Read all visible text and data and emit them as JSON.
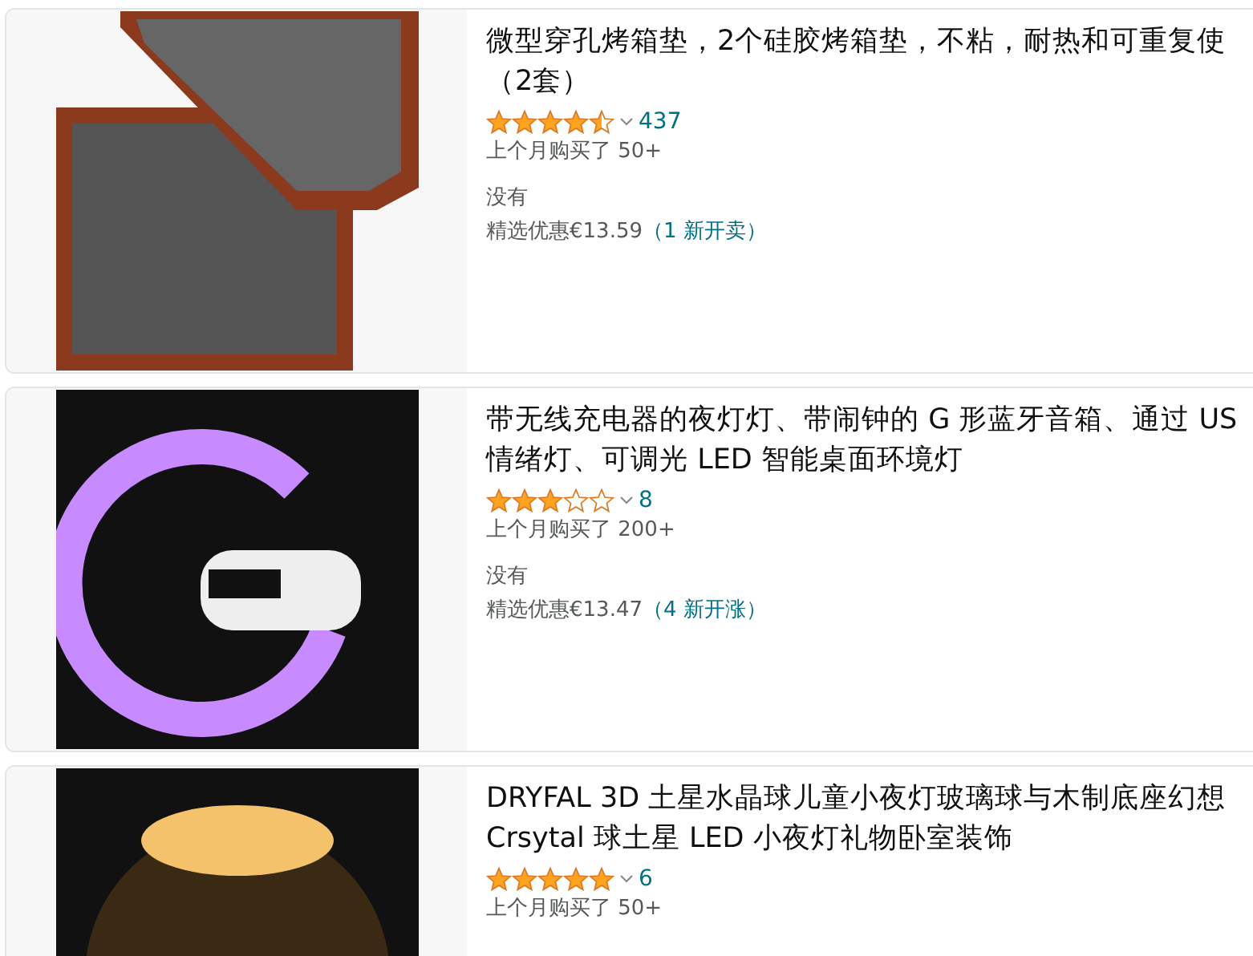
{
  "products": [
    {
      "title_lines": [
        "微型穿孔烤箱垫，2个硅胶烤箱垫，不粘，耐热和可重复使",
        "（2套）"
      ],
      "stars": 4.5,
      "review_count": "437",
      "bought": "上个月购买了 50+",
      "availability": "没有",
      "price": "精选优惠€13.59",
      "offers": "（1 新开卖）",
      "kind": "baking-mat"
    },
    {
      "title_lines": [
        "带无线充电器的夜灯灯、带闹钟的 G 形蓝牙音箱、通过 US",
        "情绪灯、可调光 LED 智能桌面环境灯"
      ],
      "stars": 3,
      "review_count": "8",
      "bought": "上个月购买了 200+",
      "availability": "没有",
      "price": "精选优惠€13.47",
      "offers": "（4 新开涨）",
      "kind": "lamp"
    },
    {
      "title_lines": [
        "DRYFAL 3D 土星水晶球儿童小夜灯玻璃球与木制底座幻想",
        "Crsytal 球土星 LED 小夜灯礼物卧室装饰"
      ],
      "stars": 5,
      "review_count": "6",
      "bought": "上个月购买了 50+",
      "kind": "crystal-ball"
    }
  ]
}
